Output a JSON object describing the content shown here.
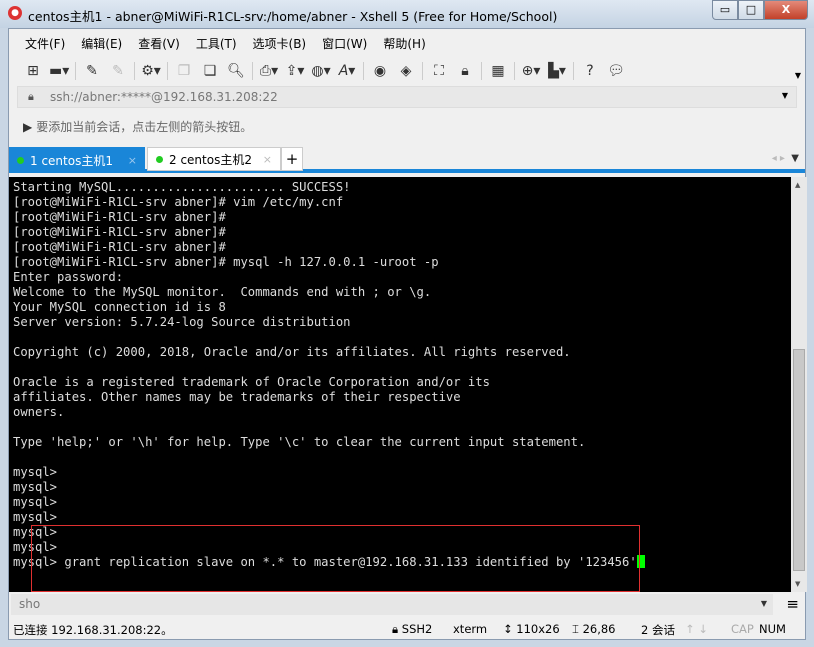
{
  "window": {
    "title": "centos主机1 - abner@MiWiFi-R1CL-srv:/home/abner - Xshell 5 (Free for Home/School)",
    "minimize": "▭",
    "maximize": "□",
    "close": "X"
  },
  "menu": [
    "文件(F)",
    "编辑(E)",
    "查看(V)",
    "工具(T)",
    "选项卡(B)",
    "窗口(W)",
    "帮助(H)"
  ],
  "address": {
    "value": "ssh://abner:*****@192.168.31.208:22"
  },
  "hint": "要添加当前会话，点击左侧的箭头按钮。",
  "tabs": [
    {
      "label": "1 centos主机1",
      "close": "×"
    },
    {
      "label": "2 centos主机2",
      "close": "×"
    }
  ],
  "add_tab": "+",
  "terminal": {
    "lines": [
      "Starting MySQL....................... SUCCESS!",
      "[root@MiWiFi-R1CL-srv abner]# vim /etc/my.cnf",
      "[root@MiWiFi-R1CL-srv abner]#",
      "[root@MiWiFi-R1CL-srv abner]#",
      "[root@MiWiFi-R1CL-srv abner]#",
      "[root@MiWiFi-R1CL-srv abner]# mysql -h 127.0.0.1 -uroot -p",
      "Enter password:",
      "Welcome to the MySQL monitor.  Commands end with ; or \\g.",
      "Your MySQL connection id is 8",
      "Server version: 5.7.24-log Source distribution",
      "",
      "Copyright (c) 2000, 2018, Oracle and/or its affiliates. All rights reserved.",
      "",
      "Oracle is a registered trademark of Oracle Corporation and/or its",
      "affiliates. Other names may be trademarks of their respective",
      "owners.",
      "",
      "Type 'help;' or '\\h' for help. Type '\\c' to clear the current input statement.",
      "",
      "mysql>",
      "mysql>",
      "mysql>",
      "mysql>",
      "mysql>",
      "mysql>"
    ],
    "current_line": "mysql> grant replication slave on *.* to master@192.168.31.133 identified by '123456'"
  },
  "command_input": {
    "value": "sho"
  },
  "status": {
    "connection": "已连接 192.168.31.208:22。",
    "protocol": "SSH2",
    "term": "xterm",
    "size": "110x26",
    "cursor": "26,86",
    "sessions": "2 会话",
    "cap": "CAP",
    "num": "NUM"
  }
}
